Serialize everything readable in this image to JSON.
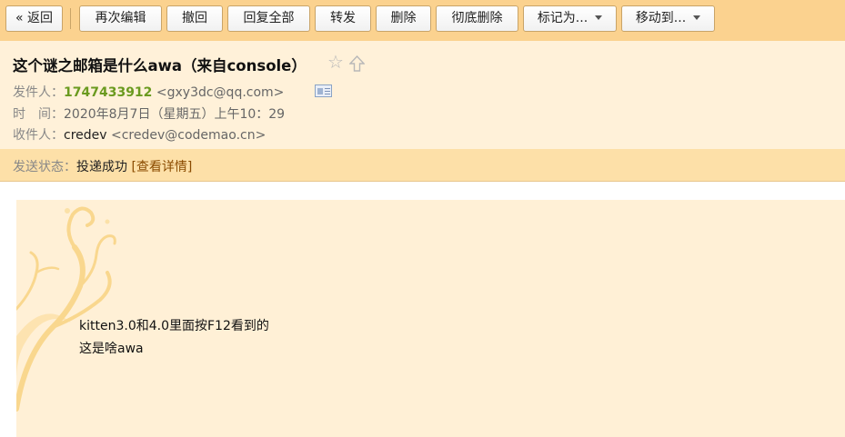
{
  "toolbar": {
    "back": "« 返回",
    "reedit": "再次编辑",
    "recall": "撤回",
    "reply_all": "回复全部",
    "forward": "转发",
    "delete": "删除",
    "delete_permanently": "彻底删除",
    "mark_as": "标记为...",
    "move_to": "移动到..."
  },
  "email": {
    "subject": "这个谜之邮箱是什么awa（来自console）",
    "from_label": "发件人：",
    "from_name": "1747433912",
    "from_address": "<gxy3dc@qq.com>",
    "time_label": "时　间：",
    "time_value": "2020年8月7日（星期五）上午10：29",
    "to_label": "收件人：",
    "to_name": "credev",
    "to_address": "<credev@codemao.cn>",
    "status_label": "发送状态：",
    "status_value": "投递成功",
    "status_link": "[查看详情]",
    "body_lines": [
      "kitten3.0和4.0里面按F12看到的",
      "这是啥awa"
    ]
  },
  "colors": {
    "toolbar_bg": "#fbd28f",
    "header_bg": "#fff1d9",
    "status_bg": "#fde0a8",
    "body_bg": "#fff0d6",
    "sender_name": "#6a9a1f"
  }
}
